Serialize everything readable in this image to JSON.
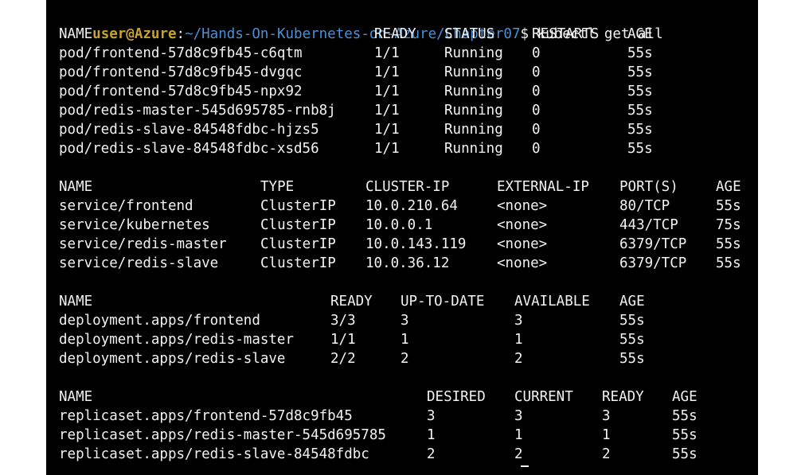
{
  "prompt": {
    "user_host": "user@Azure",
    "separator": ":",
    "path": "~/Hands-On-Kubernetes-on-Azure/Chapter07",
    "dollar": "$",
    "command": " kubectl get all"
  },
  "pods": {
    "headers": [
      "NAME",
      "READY",
      "STATUS",
      "RESTARTS",
      "AGE"
    ],
    "rows": [
      [
        "pod/frontend-57d8c9fb45-c6qtm",
        "1/1",
        "Running",
        "0",
        "55s"
      ],
      [
        "pod/frontend-57d8c9fb45-dvgqc",
        "1/1",
        "Running",
        "0",
        "55s"
      ],
      [
        "pod/frontend-57d8c9fb45-npx92",
        "1/1",
        "Running",
        "0",
        "55s"
      ],
      [
        "pod/redis-master-545d695785-rnb8j",
        "1/1",
        "Running",
        "0",
        "55s"
      ],
      [
        "pod/redis-slave-84548fdbc-hjzs5",
        "1/1",
        "Running",
        "0",
        "55s"
      ],
      [
        "pod/redis-slave-84548fdbc-xsd56",
        "1/1",
        "Running",
        "0",
        "55s"
      ]
    ]
  },
  "services": {
    "headers": [
      "NAME",
      "TYPE",
      "CLUSTER-IP",
      "EXTERNAL-IP",
      "PORT(S)",
      "AGE"
    ],
    "rows": [
      [
        "service/frontend",
        "ClusterIP",
        "10.0.210.64",
        "<none>",
        "80/TCP",
        "55s"
      ],
      [
        "service/kubernetes",
        "ClusterIP",
        "10.0.0.1",
        "<none>",
        "443/TCP",
        "75s"
      ],
      [
        "service/redis-master",
        "ClusterIP",
        "10.0.143.119",
        "<none>",
        "6379/TCP",
        "55s"
      ],
      [
        "service/redis-slave",
        "ClusterIP",
        "10.0.36.12",
        "<none>",
        "6379/TCP",
        "55s"
      ]
    ]
  },
  "deployments": {
    "headers": [
      "NAME",
      "READY",
      "UP-TO-DATE",
      "AVAILABLE",
      "AGE"
    ],
    "rows": [
      [
        "deployment.apps/frontend",
        "3/3",
        "3",
        "3",
        "55s"
      ],
      [
        "deployment.apps/redis-master",
        "1/1",
        "1",
        "1",
        "55s"
      ],
      [
        "deployment.apps/redis-slave",
        "2/2",
        "2",
        "2",
        "55s"
      ]
    ]
  },
  "replicasets": {
    "headers": [
      "NAME",
      "DESIRED",
      "CURRENT",
      "READY",
      "AGE"
    ],
    "rows": [
      [
        "replicaset.apps/frontend-57d8c9fb45",
        "3",
        "3",
        "3",
        "55s"
      ],
      [
        "replicaset.apps/redis-master-545d695785",
        "1",
        "1",
        "1",
        "55s"
      ],
      [
        "replicaset.apps/redis-slave-84548fdbc",
        "2",
        "2",
        "2",
        "55s"
      ]
    ]
  },
  "colors": {
    "background": "#000000",
    "text": "#f2f2f2",
    "prompt_user": "#c8a230",
    "prompt_path": "#4b8fd6"
  }
}
